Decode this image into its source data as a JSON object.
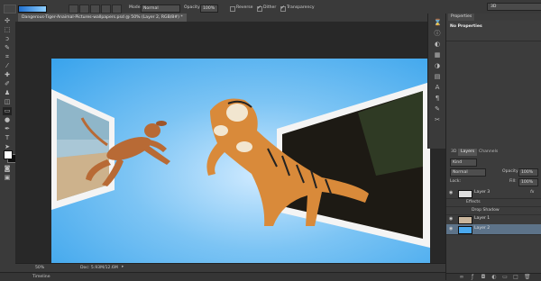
{
  "options": {
    "mode_label": "Mode:",
    "mode_value": "Normal",
    "opacity_label": "Opacity:",
    "opacity_value": "100%",
    "reverse_label": "Reverse",
    "dither_label": "Dither",
    "transparency_label": "Transparency",
    "workspace": "3D"
  },
  "document": {
    "tab_title": "Dangerous-Tiger-Anaimal-Pictures-wallpapers.psd @ 50% (Layer 2, RGB/8#) *",
    "zoom": "50%",
    "doc_size": "Doc: 5.93M/12.6M"
  },
  "timeline": {
    "label": "Timeline"
  },
  "properties": {
    "tab": "Properties",
    "content": "No Properties"
  },
  "layers_panel": {
    "tabs": [
      "3D",
      "Layers",
      "Channels"
    ],
    "kind_value": "Kind",
    "blend_value": "Normal",
    "opacity_label": "Opacity:",
    "opacity_value": "100%",
    "lock_label": "Lock:",
    "fill_label": "Fill:",
    "fill_value": "100%",
    "layers": [
      {
        "name": "Layer 3",
        "fx": "fx"
      },
      {
        "name": "Effects"
      },
      {
        "name": "Drop Shadow"
      },
      {
        "name": "Layer 1"
      },
      {
        "name": "Layer 2"
      }
    ]
  },
  "colors": {
    "accent": "#5d7389",
    "canvas_blue": "#38a3ec"
  }
}
